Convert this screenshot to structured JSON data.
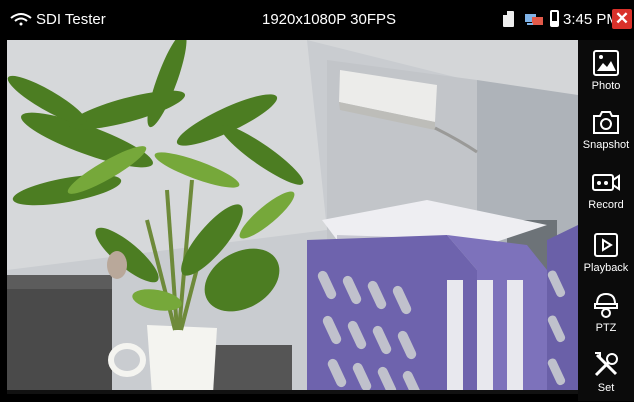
{
  "status_bar": {
    "title": "SDI Tester",
    "resolution": "1920x1080P 30FPS",
    "time": "3:45 PM",
    "close_symbol": "✕"
  },
  "video_feed": {
    "icons": [
      "wifi-icon",
      "sd-card-icon",
      "network-icon",
      "battery-icon",
      "close-icon"
    ]
  },
  "sidebar": {
    "items": [
      {
        "label": "Photo",
        "icon": "photo-icon"
      },
      {
        "label": "Snapshot",
        "icon": "camera-icon"
      },
      {
        "label": "Record",
        "icon": "video-record-icon"
      },
      {
        "label": "Playback",
        "icon": "play-icon"
      },
      {
        "label": "PTZ",
        "icon": "ptz-camera-icon"
      },
      {
        "label": "Set",
        "icon": "tools-icon"
      }
    ]
  },
  "colors": {
    "close": "#d9312a",
    "background": "#000000"
  }
}
